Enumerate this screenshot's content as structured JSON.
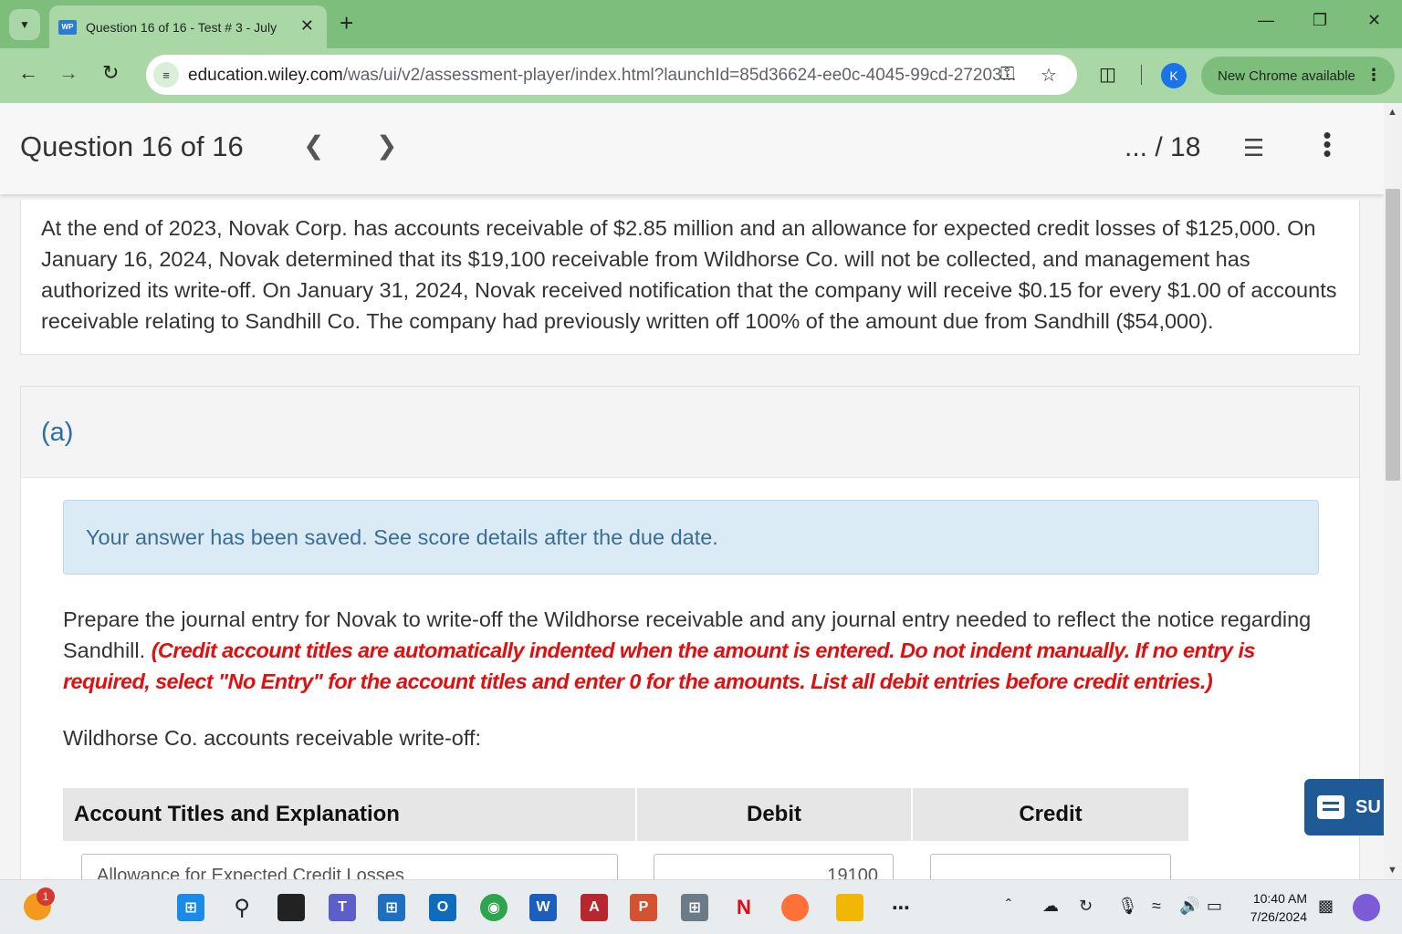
{
  "browser": {
    "tab": {
      "favicon": "WP",
      "title": "Question 16 of 16 - Test # 3 - July"
    },
    "url": {
      "host": "education.wiley.com",
      "path": "/was/ui/v2/assessment-player/index.html?launchId=85d36624-ee0c-4045-99cd-27203..."
    },
    "profile_initial": "K",
    "update_label": "New Chrome available"
  },
  "header": {
    "question_label": "Question 16 of 16",
    "score": "... / 18"
  },
  "problem": {
    "text": "At the end of 2023, Novak Corp. has accounts receivable of $2.85 million and an allowance for expected credit losses of $125,000. On January 16, 2024, Novak determined that its $19,100 receivable from Wildhorse Co. will not be collected, and management has authorized its write-off. On January 31, 2024, Novak received notification that the company will receive $0.15 for every $1.00 of accounts receivable relating to Sandhill Co. The company had previously written off 100% of the amount due from Sandhill ($54,000)."
  },
  "part": {
    "label": "(a)",
    "saved_message": "Your answer has been saved. See score details after the due date.",
    "instructions": "Prepare the journal entry for Novak to write-off the Wildhorse receivable and any journal entry needed to reflect the notice regarding Sandhill.",
    "instructions_note": "(Credit account titles are automatically indented when the amount is entered. Do not indent manually. If no entry is required, select \"No Entry\" for the account titles and enter 0 for the amounts. List all debit entries before credit entries.)",
    "subheading": "Wildhorse Co. accounts receivable write-off:",
    "table": {
      "headers": [
        "Account Titles and Explanation",
        "Debit",
        "Credit"
      ],
      "row1": {
        "account": "Allowance for Expected Credit Losses",
        "debit": "19100",
        "credit": ""
      }
    }
  },
  "submit_label": "SU",
  "taskbar": {
    "weather_badge": "1",
    "time": "10:40 AM",
    "date": "7/26/2024"
  },
  "colors": {
    "tab_strip": "#7dbe7d",
    "toolbar": "#a9d8a6",
    "part_label": "#2a6ea6",
    "saved_bg": "#daebf5",
    "instruction_note": "#e01010",
    "submit": "#1f5a96"
  }
}
